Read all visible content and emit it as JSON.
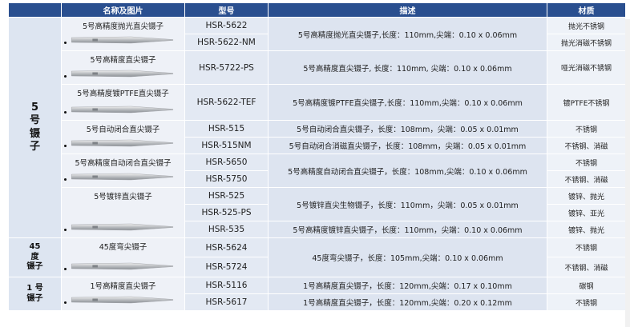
{
  "header": {
    "name": "名称及图片",
    "model": "型号",
    "desc": "描述",
    "material": "材质"
  },
  "groups": [
    {
      "label": "5\n号\n镊\n子",
      "products": [
        {
          "name": "5号高精度抛光直尖镊子",
          "desc": "5号高精度抛光直尖镊子,长度：110mm,尖端：0.10 x 0.06mm",
          "variants": [
            {
              "model": "HSR-5622",
              "material": "抛光不锈钢"
            },
            {
              "model": "HSR-5622-NM",
              "material": "抛光消磁不锈钢"
            }
          ]
        },
        {
          "name": "5号高精度直尖镊子",
          "desc": "5号高精度直尖镊子, 长度：110mm, 尖端：0.10 x 0.06mm",
          "variants": [
            {
              "model": "HSR-5722-PS",
              "material": "哑光消磁不锈钢"
            }
          ]
        },
        {
          "name": "5号高精度镀PTFE直尖镊子",
          "desc": "5号高精度镀PTFE直尖镊子,长度：110mm,尖端：0.10 x 0.06mm",
          "variants": [
            {
              "model": "HSR-5622-TEF",
              "material": "镀PTFE不锈钢"
            }
          ]
        },
        {
          "name": "5号自动闭合直尖镊子",
          "desc": null,
          "variants": [
            {
              "model": "HSR-515",
              "material": "不锈钢",
              "desc": "5号自动闭合直尖镊子，长度：108mm，尖端：0.05 x 0.01mm"
            },
            {
              "model": "HSR-515NM",
              "material": "不锈钢、消磁",
              "desc": "5号自动闭合消磁直尖镊子，长度：108mm，尖端：0.05 x 0.01mm"
            }
          ]
        },
        {
          "name": "5号高精度自动闭合直尖镊子",
          "desc": "5号高精度自动闭合直尖镊子，长度：108mm,尖端：0.10 x 0.06mm",
          "variants": [
            {
              "model": "HSR-5650",
              "material": "不锈钢"
            },
            {
              "model": "HSR-5750",
              "material": "不锈钢、消磁"
            }
          ]
        },
        {
          "name": "5号镀锌直尖镊子",
          "desc": null,
          "variants": [
            {
              "model": "HSR-525",
              "material": "镀锌、抛光",
              "desc": "5号镀锌直尖生物镊子，长度：110mm，尖端：0.05 x 0.01mm",
              "descspan": 2
            },
            {
              "model": "HSR-525-PS",
              "material": "镀锌、亚光"
            },
            {
              "model": "HSR-535",
              "material": "镀锌、抛光",
              "desc": "5号高精度镀锌直尖镊子，长度：110mm，尖端：0.10 x 0.06mm"
            }
          ]
        }
      ]
    },
    {
      "label": "45\n度\n镊子",
      "products": [
        {
          "name": "45度弯尖镊子",
          "desc": "45度弯尖镊子，长度：105mm,尖端：0.10 x 0.06mm",
          "variants": [
            {
              "model": "HSR-5624",
              "material": "不锈钢"
            },
            {
              "model": "HSR-5724",
              "material": "不锈钢、消磁"
            }
          ]
        }
      ]
    },
    {
      "label": "1 号\n镊子",
      "products": [
        {
          "name": "1号高精度直尖镊子",
          "desc": null,
          "variants": [
            {
              "model": "HSR-5116",
              "material": "碳钢",
              "desc": "1号高精度直尖镊子，长度：120mm,尖端：0.17 x 0.10mm"
            },
            {
              "model": "HSR-5617",
              "material": "不锈钢",
              "desc": "1号高精度直尖镊子，长度：120mm,尖端：0.20 x 0.12mm"
            }
          ]
        }
      ]
    }
  ]
}
